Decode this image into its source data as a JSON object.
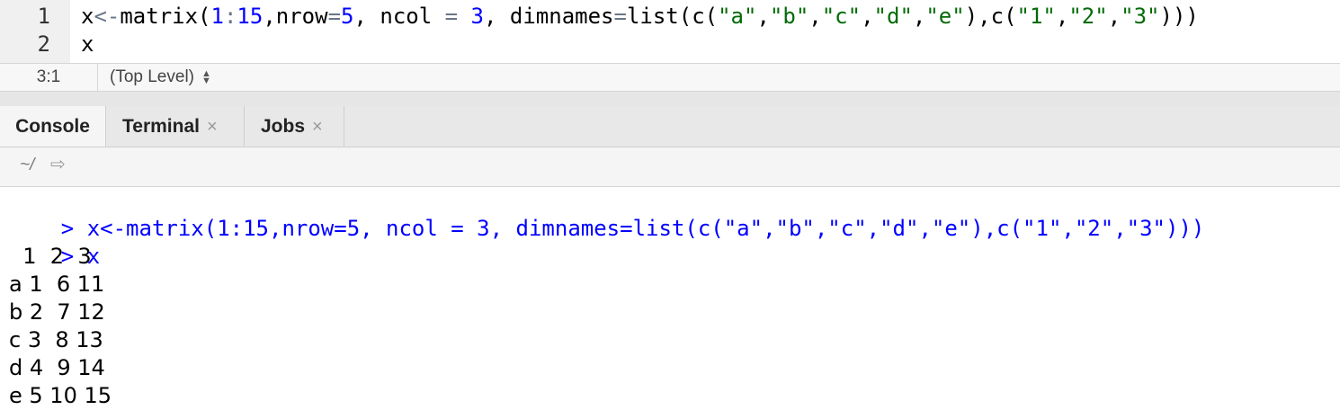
{
  "editor": {
    "lines": [
      {
        "number": "1",
        "code": "x<-matrix(1:15,nrow=5, ncol = 3, dimnames=list(c(\"a\",\"b\",\"c\",\"d\",\"e\"),c(\"1\",\"2\",\"3\")))"
      },
      {
        "number": "2",
        "code": "x"
      }
    ]
  },
  "statusbar": {
    "cursor_position": "3:1",
    "scope": "(Top Level)"
  },
  "tabs": [
    {
      "label": "Console",
      "active": true
    },
    {
      "label": "Terminal",
      "close": "×"
    },
    {
      "label": "Jobs",
      "close": "×"
    }
  ],
  "console_toolbar": {
    "working_dir": "~/"
  },
  "console": {
    "prompt": ">",
    "commands": [
      "x<-matrix(1:15,nrow=5, ncol = 3, dimnames=list(c(\"a\",\"b\",\"c\",\"d\",\"e\"),c(\"1\",\"2\",\"3\")))",
      "x"
    ],
    "output": [
      "  1  2  3",
      "a 1  6 11",
      "b 2  7 12",
      "c 3  8 13",
      "d 4  9 14",
      "e 5 10 15"
    ]
  },
  "colors": {
    "keyword_blue": "#0000ff",
    "string_green": "#036a07",
    "operator_gray": "#687687"
  }
}
